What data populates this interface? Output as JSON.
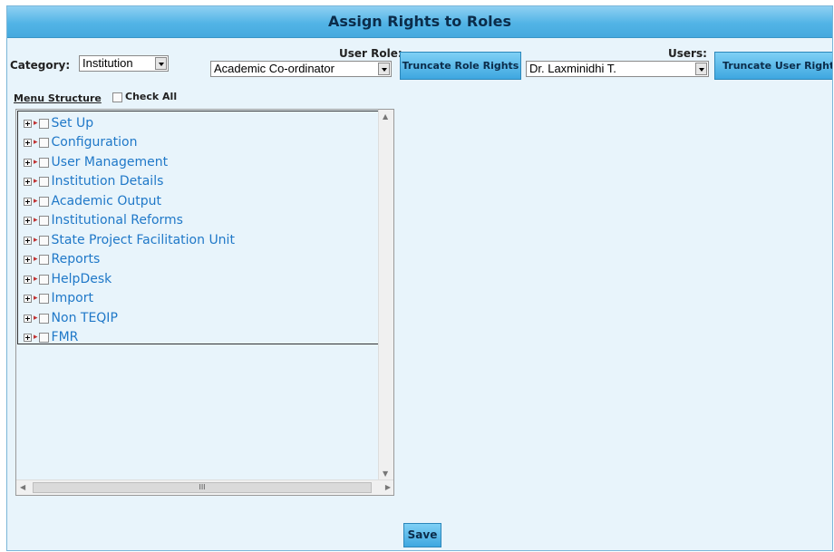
{
  "page": {
    "title": "Assign Rights to Roles"
  },
  "filters": {
    "category_label": "Category:",
    "category_value": "Institution",
    "user_role_label": "User Role:",
    "user_role_value": "Academic Co-ordinator",
    "users_label": "Users:",
    "users_value": "Dr. Laxminidhi T."
  },
  "buttons": {
    "truncate_role": "Truncate Role Rights",
    "truncate_user": "Truncate User Rights",
    "save": "Save"
  },
  "menu": {
    "label": "Menu Structure",
    "check_all": "Check All",
    "items": [
      "Set Up",
      "Configuration",
      "User Management",
      "Institution Details",
      "Academic Output",
      "Institutional Reforms",
      "State Project Facilitation Unit",
      "Reports",
      "HelpDesk",
      "Import",
      "Non TEQIP",
      "FMR"
    ]
  },
  "scrollbar": {
    "thumb_grip": "III"
  },
  "colors": {
    "title_bar": "#52b4e6",
    "button": "#3ea7e0",
    "panel_bg": "#e8f4fb",
    "tree_link": "#1f78c8"
  }
}
